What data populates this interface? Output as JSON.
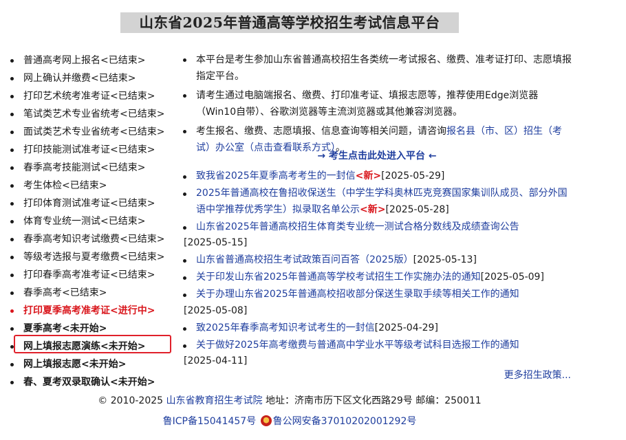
{
  "header": {
    "title": "山东省2025年普通高等学校招生考试信息平台"
  },
  "sidebar": {
    "items": [
      {
        "label": "普通高考网上报名<已结束>",
        "state": "ended"
      },
      {
        "label": "网上确认并缴费<已结束>",
        "state": "ended"
      },
      {
        "label": "打印艺术统考准考证<已结束>",
        "state": "ended"
      },
      {
        "label": "笔试类艺术专业省统考<已结束>",
        "state": "ended"
      },
      {
        "label": "面试类艺术专业省统考<已结束>",
        "state": "ended"
      },
      {
        "label": "打印技能测试准考证<已结束>",
        "state": "ended"
      },
      {
        "label": "春季高考技能测试<已结束>",
        "state": "ended"
      },
      {
        "label": "考生体检<已结束>",
        "state": "ended"
      },
      {
        "label": "打印体育测试准考证<已结束>",
        "state": "ended"
      },
      {
        "label": "体育专业统一测试<已结束>",
        "state": "ended"
      },
      {
        "label": "春季高考知识考试缴费<已结束>",
        "state": "ended"
      },
      {
        "label": "等级考选报与夏考缴费<已结束>",
        "state": "ended"
      },
      {
        "label": "打印春季高考准考证<已结束>",
        "state": "ended"
      },
      {
        "label": "春季高考<已结束>",
        "state": "ended"
      },
      {
        "label": "打印夏季高考准考证<进行中>",
        "state": "active"
      },
      {
        "label": "夏季高考<未开始>",
        "state": "pending"
      },
      {
        "label": "网上填报志愿演练<未开始>",
        "state": "pending"
      },
      {
        "label": "网上填报志愿<未开始>",
        "state": "pending"
      },
      {
        "label": "春、夏考双录取确认<未开始>",
        "state": "pending"
      }
    ]
  },
  "info": {
    "p1": "本平台是考生参加山东省普通高校招生各类统一考试报名、缴费、准考证打印、志愿填报指定平台。",
    "p2": "请考生通过电脑端报名、缴费、打印准考证、填报志愿等，推荐使用Edge浏览器（Win10自带）、谷歌浏览器等主流浏览器或其他兼容浏览器。",
    "p3_text": "考生报名、缴费、志愿填报、信息查询等相关问题，请咨询",
    "p3_link": "报名县（市、区）招生（考试）办公室（点击查看联系方式）",
    "p3_end": "。",
    "enter_link": "→ 考生点击此处进入平台 ←"
  },
  "news": {
    "items": [
      {
        "title": "致我省2025年夏季高考考生的一封信",
        "new_tag": "<新>",
        "date": "[2025-05-29]"
      },
      {
        "title": "2025年普通高校在鲁招收保送生（中学生学科奥林匹克竞赛国家集训队成员、部分外国语中学推荐优秀学生）拟录取名单公示",
        "new_tag": "<新>",
        "date": "[2025-05-28]"
      },
      {
        "title": "山东省2025年普通高校招生体育类专业统一测试合格分数线及成绩查询公告",
        "new_tag": "",
        "date": "[2025-05-15]"
      },
      {
        "title": "山东省普通高校招生考试政策百问百答（2025版）",
        "new_tag": "",
        "date": "[2025-05-13]"
      },
      {
        "title": "关于印发山东省2025年普通高等学校考试招生工作实施办法的通知",
        "new_tag": "",
        "date": "[2025-05-09]"
      },
      {
        "title": "关于办理山东省2025年普通高校招收部分保送生录取手续等相关工作的通知",
        "new_tag": "",
        "date": "[2025-05-08]"
      },
      {
        "title": "致2025年春季高考知识考试考生的一封信",
        "new_tag": "",
        "date": "[2025-04-29]"
      },
      {
        "title": "关于做好2025年高考缴费与普通高中学业水平等级考试科目选报工作的通知",
        "new_tag": "",
        "date": "[2025-04-11]"
      }
    ],
    "more": "更多招生政策..."
  },
  "footer": {
    "copyright": "© 2010-2025",
    "org_link": "山东省教育招生考试院",
    "address": "地址：济南市历下区文化西路29号 邮编：250011",
    "icp": "鲁ICP备15041457号",
    "police": "鲁公网安备37010202001292号",
    "police_icon": "police-badge-icon"
  },
  "colors": {
    "link": "#1f3e9e",
    "active": "#d9161c",
    "highlight_box": "#e0202a",
    "title_bg": "#d3d3d3"
  }
}
